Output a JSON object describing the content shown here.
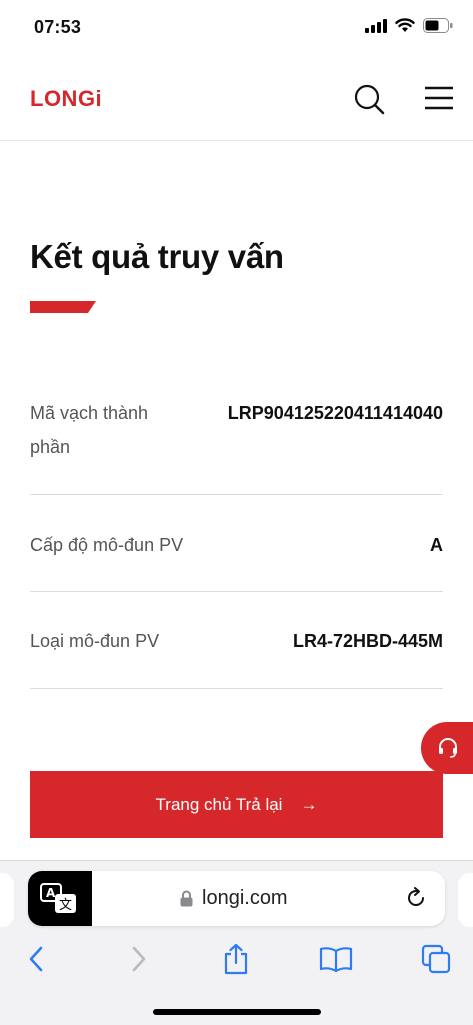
{
  "status_bar": {
    "time": "07:53"
  },
  "header": {
    "logo_text": "LONGi"
  },
  "page": {
    "title": "Kết quả truy vấn",
    "rows": [
      {
        "label": "Mã vạch thành phần",
        "value": "LRP904125220411414040"
      },
      {
        "label": "Cấp độ mô-đun PV",
        "value": "A"
      },
      {
        "label": "Loại mô-đun PV",
        "value": "LR4-72HBD-445M"
      }
    ],
    "back_button": {
      "label": "Trang chủ Trả lại",
      "arrow": "→"
    }
  },
  "browser": {
    "url": "longi.com"
  },
  "colors": {
    "brand_red": "#d6282b",
    "ios_blue": "#2f7bf5"
  },
  "icons": [
    "search-icon",
    "hamburger-menu-icon",
    "headset-icon",
    "translate-icon",
    "lock-icon",
    "reload-icon",
    "back-icon",
    "forward-icon",
    "share-icon",
    "bookmarks-icon",
    "tabs-icon"
  ]
}
